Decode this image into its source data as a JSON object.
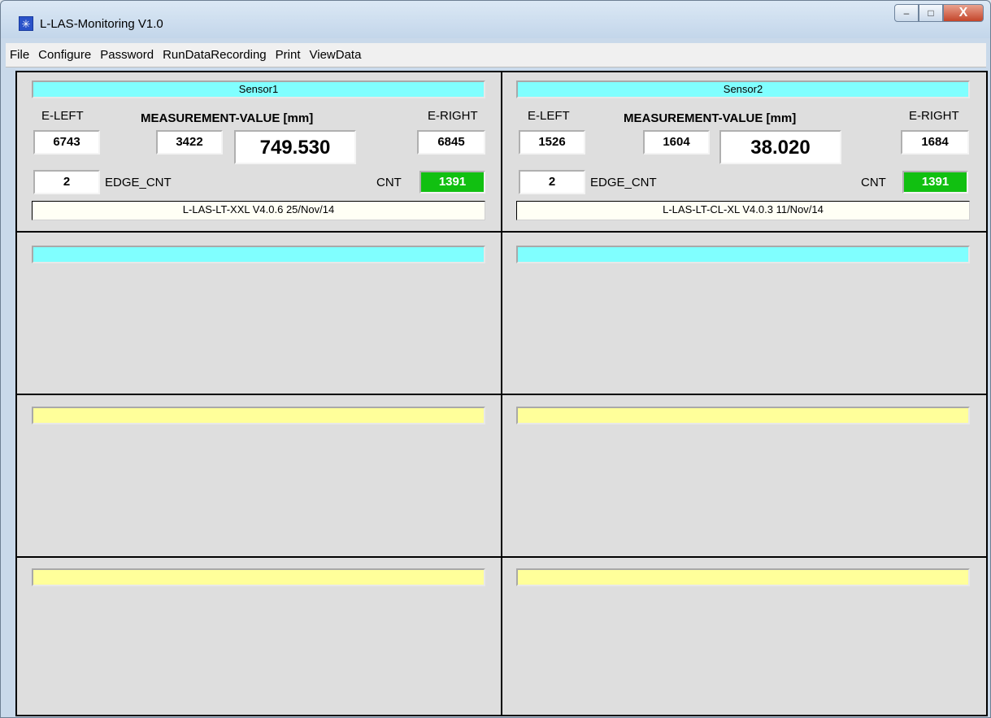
{
  "window": {
    "title": "L-LAS-Monitoring V1.0",
    "app_icon": "starburst-app-icon",
    "controls": {
      "minimize": "–",
      "maximize": "□",
      "close": "X"
    }
  },
  "menu": [
    "File",
    "Configure",
    "Password",
    "RunDataRecording",
    "Print",
    "ViewData"
  ],
  "sensors": [
    {
      "name": "Sensor1",
      "e_left_label": "E-LEFT",
      "measurement_label": "MEASUREMENT-VALUE [mm]",
      "e_right_label": "E-RIGHT",
      "e_left": "6743",
      "mid": "3422",
      "value": "749.530",
      "e_right": "6845",
      "edge_cnt": "2",
      "edge_cnt_label": "EDGE_CNT",
      "cnt_label": "CNT",
      "cnt": "1391",
      "version": "L-LAS-LT-XXL  V4.0.6  25/Nov/14"
    },
    {
      "name": "Sensor2",
      "e_left_label": "E-LEFT",
      "measurement_label": "MEASUREMENT-VALUE [mm]",
      "e_right_label": "E-RIGHT",
      "e_left": "1526",
      "mid": "1604",
      "value": "38.020",
      "e_right": "1684",
      "edge_cnt": "2",
      "edge_cnt_label": "EDGE_CNT",
      "cnt_label": "CNT",
      "cnt": "1391",
      "version": "L-LAS-LT-CL-XL  V4.0.3  11/Nov/14"
    }
  ],
  "colors": {
    "header_cyan": "#80ffff",
    "header_yellow": "#ffff9a",
    "cnt_green": "#11c011",
    "panel_bg": "#dedede"
  }
}
